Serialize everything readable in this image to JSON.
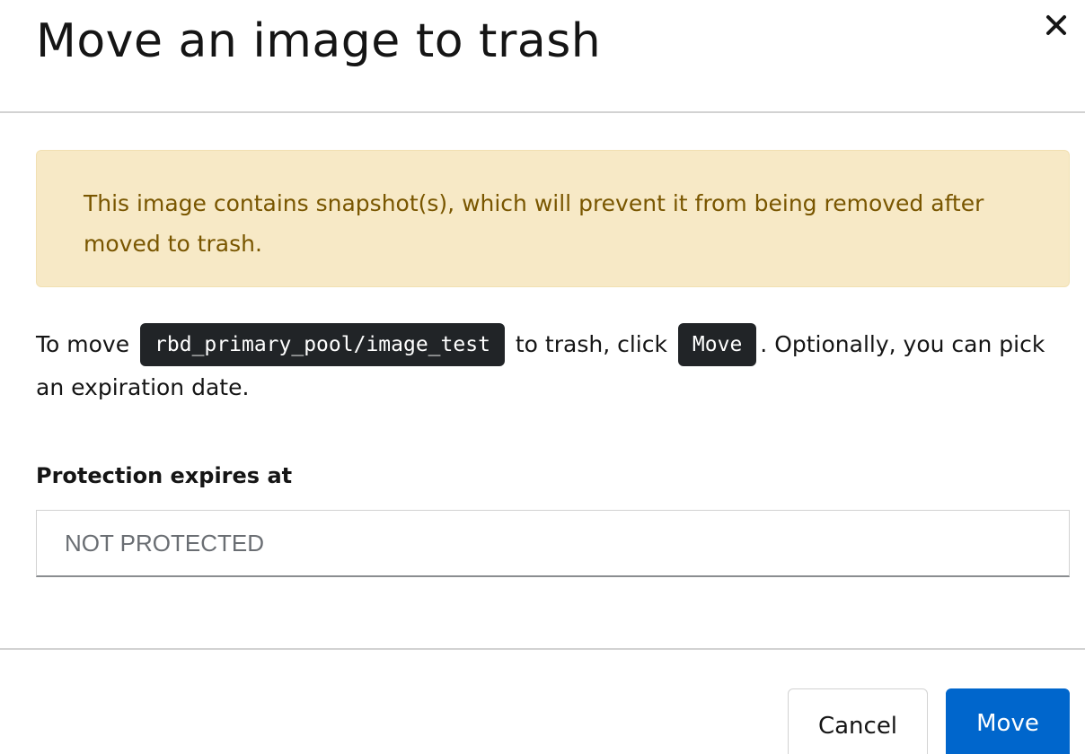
{
  "modal": {
    "title": "Move an image to trash",
    "close_icon": "close-icon"
  },
  "alert": {
    "text": "This image contains snapshot(s), which will prevent it from being removed after moved to trash."
  },
  "body": {
    "text_before": "To move",
    "image_path": "rbd_primary_pool/image_test",
    "text_middle": "to trash, click",
    "action_code": "Move",
    "text_after": ". Optionally, you can pick an expiration date."
  },
  "form": {
    "label": "Protection expires at",
    "placeholder": "NOT PROTECTED",
    "value": ""
  },
  "footer": {
    "cancel_label": "Cancel",
    "move_label": "Move"
  },
  "colors": {
    "primary": "#0066cc",
    "warning_bg": "#f7e9c6",
    "warning_text": "#795600",
    "code_bg": "#212427"
  }
}
